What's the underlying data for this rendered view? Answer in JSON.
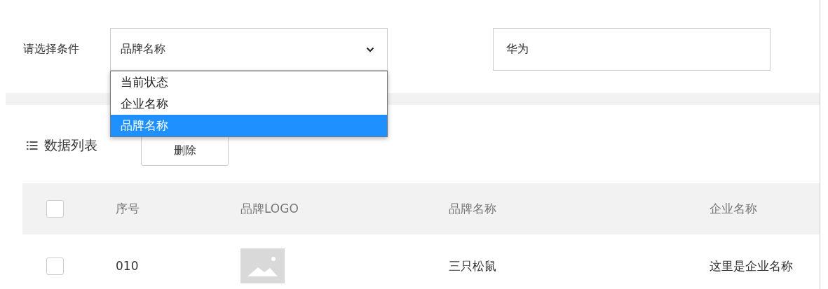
{
  "filter": {
    "label": "请选择条件",
    "select": {
      "value": "品牌名称",
      "expanded": true,
      "options": [
        {
          "label": "当前状态",
          "selected": false
        },
        {
          "label": "企业名称",
          "selected": false
        },
        {
          "label": "品牌名称",
          "selected": true
        }
      ]
    },
    "search": {
      "value": "华为"
    }
  },
  "list": {
    "title": "数据列表",
    "delete_button": "删除"
  },
  "table": {
    "select_all_checked": false,
    "columns": [
      "序号",
      "品牌LOGO",
      "品牌名称",
      "企业名称"
    ],
    "rows": [
      {
        "checked": false,
        "number": "010",
        "brand": "三只松鼠",
        "company": "这里是企业名称"
      }
    ]
  }
}
